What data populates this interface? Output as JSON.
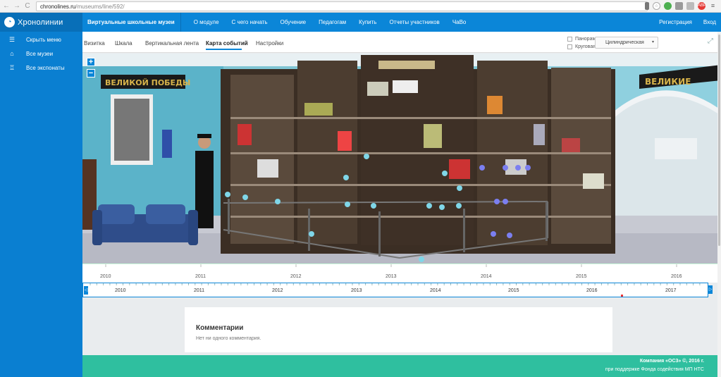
{
  "browser": {
    "url_host": "chronolines.ru",
    "url_path": "/museums/line/592/"
  },
  "sidebar": {
    "logo_text": "Хронолинии",
    "items": [
      {
        "label": "Скрыть меню",
        "icon": "menu-icon"
      },
      {
        "label": "Все музеи",
        "icon": "museum-icon"
      },
      {
        "label": "Все экспонаты",
        "icon": "medal-icon"
      }
    ]
  },
  "topnav": {
    "brand": "Виртуальные школьные музеи",
    "items": [
      "О модуле",
      "С чего начать",
      "Обучение",
      "Педагогам",
      "Купить",
      "Отчеты участников",
      "ЧаВо"
    ],
    "register": "Регистрация",
    "login": "Вход"
  },
  "subbar": {
    "tabs": [
      "Визитка",
      "Шкала",
      "Вертикальная лента",
      "Карта событий",
      "Настройки"
    ],
    "active_tab": "Карта событий",
    "checkbox_panorama": "Панорама",
    "checkbox_circular": "Круговая",
    "projection_value": "Цилиндрическая"
  },
  "panorama": {
    "banner_left": "ВЕЛИКОЙ ПОБЕДЫ",
    "banner_right": "ВЕЛИКИЕ",
    "zoom_in": "+",
    "zoom_out": "−"
  },
  "timeline_top": [
    "2010",
    "2011",
    "2012",
    "2013",
    "2014",
    "2015",
    "2016"
  ],
  "timeline_bottom": [
    "2010",
    "2011",
    "2012",
    "2013",
    "2014",
    "2015",
    "2016",
    "2017"
  ],
  "comments": {
    "title": "Комментарии",
    "empty_text": "Нет ни одного комментария."
  },
  "footer": {
    "line1": "Компания «ОС3» ©, 2016 г.",
    "line2": "при поддержке Фонда содействия МП НТС"
  },
  "colors": {
    "primary": "#0b86d8",
    "sidebar": "#0a7fd1",
    "footer": "#2fbf9f",
    "pin": "#7fd6e8",
    "pin_purple": "#7b7ff0"
  }
}
